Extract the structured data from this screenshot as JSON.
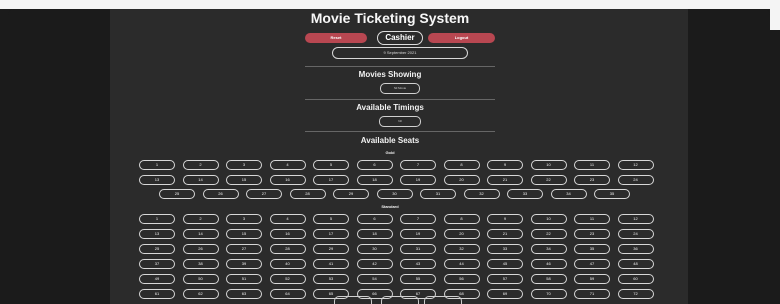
{
  "app": {
    "title": "Movie Ticketing System",
    "role_label": "Cashier"
  },
  "header": {
    "reset_label": "Reset",
    "logout_label": "Logout",
    "date": "9 September 2021"
  },
  "movies": {
    "heading": "Movies Showing",
    "selected": "Nil Movie"
  },
  "timings": {
    "heading": "Available Timings",
    "selected": "Nil"
  },
  "seats": {
    "heading": "Available Seats",
    "gold_label": "Gold",
    "standard_label": "Standard",
    "gold_row1": [
      "1",
      "2",
      "3",
      "4",
      "5",
      "6",
      "7",
      "8",
      "9",
      "10",
      "11",
      "12"
    ],
    "gold_row2": [
      "13",
      "14",
      "15",
      "16",
      "17",
      "18",
      "19",
      "20",
      "21",
      "22",
      "23",
      "24"
    ],
    "gold_row3": [
      "25",
      "26",
      "27",
      "28",
      "29",
      "30",
      "31",
      "32",
      "33",
      "34",
      "35"
    ],
    "standard_rows": [
      [
        "1",
        "2",
        "3",
        "4",
        "5",
        "6",
        "7",
        "8",
        "9",
        "10",
        "11",
        "12"
      ],
      [
        "13",
        "14",
        "15",
        "16",
        "17",
        "18",
        "19",
        "20",
        "21",
        "22",
        "23",
        "24"
      ],
      [
        "25",
        "26",
        "27",
        "28",
        "29",
        "30",
        "31",
        "32",
        "33",
        "34",
        "35",
        "36"
      ],
      [
        "37",
        "38",
        "39",
        "40",
        "41",
        "42",
        "43",
        "44",
        "45",
        "46",
        "47",
        "48"
      ],
      [
        "49",
        "50",
        "51",
        "52",
        "53",
        "54",
        "55",
        "56",
        "57",
        "58",
        "59",
        "60"
      ],
      [
        "61",
        "62",
        "63",
        "64",
        "65",
        "66",
        "67",
        "68",
        "69",
        "70",
        "71",
        "72"
      ]
    ]
  },
  "colors": {
    "background": "#1b1b1b",
    "panel": "#2b2b2b",
    "accent": "#b84751",
    "outline": "#d7d7d7"
  }
}
